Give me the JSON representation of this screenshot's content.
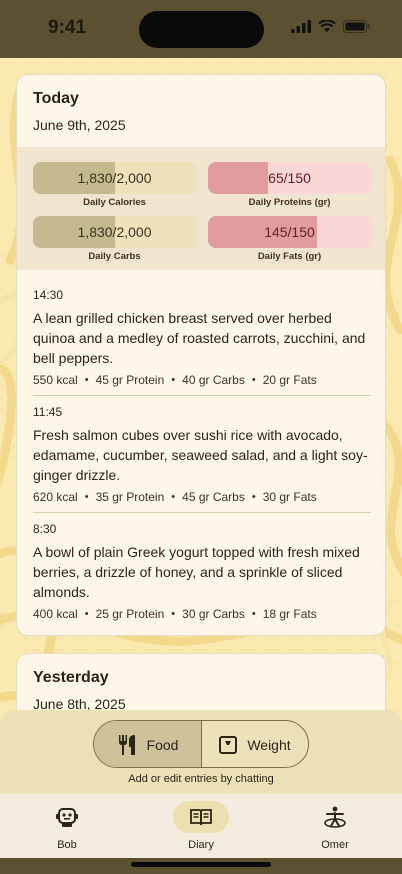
{
  "status": {
    "time": "9:41"
  },
  "today": {
    "title": "Today",
    "date": "June 9th, 2025",
    "stats": [
      {
        "value": "1,830/2,000",
        "label": "Daily Calories",
        "progress": 0.5,
        "color": "#c5b98f"
      },
      {
        "value": "65/150",
        "label": "Daily Proteins (gr)",
        "progress": 0.37,
        "color": "#e09c9f"
      },
      {
        "value": "1,830/2,000",
        "label": "Daily Carbs",
        "progress": 0.5,
        "color": "#c5b98f"
      },
      {
        "value": "145/150",
        "label": "Daily Fats (gr)",
        "progress": 0.67,
        "color": "#e09c9f"
      }
    ],
    "entries": [
      {
        "time": "14:30",
        "description": "A lean grilled chicken breast served over herbed quinoa and a medley of roasted carrots, zucchini, and bell peppers.",
        "kcal": "550 kcal",
        "protein": "45 gr Protein",
        "carbs": "40 gr Carbs",
        "fats": "20 gr Fats"
      },
      {
        "time": "11:45",
        "description": "Fresh salmon cubes over sushi rice with avocado, edamame, cucumber, seaweed salad, and a light soy-ginger drizzle.",
        "kcal": "620 kcal",
        "protein": "35 gr Protein",
        "carbs": "45 gr Carbs",
        "fats": "30 gr Fats"
      },
      {
        "time": "8:30",
        "description": "A bowl of plain Greek yogurt topped with fresh mixed berries, a drizzle of honey, and a sprinkle of sliced almonds.",
        "kcal": "400 kcal",
        "protein": "25 gr Protein",
        "carbs": "30 gr Carbs",
        "fats": "18 gr Fats"
      }
    ],
    "separator": "•"
  },
  "yesterday": {
    "title": "Yesterday",
    "date": "June 8th, 2025"
  },
  "composer": {
    "segments": [
      {
        "label": "Food",
        "icon": "fork-knife-icon",
        "active": true
      },
      {
        "label": "Weight",
        "icon": "scale-icon",
        "active": false
      }
    ],
    "hint": "Add or edit entries by chatting"
  },
  "nav": {
    "items": [
      {
        "label": "Bob",
        "icon": "robot-icon",
        "active": false
      },
      {
        "label": "Diary",
        "icon": "book-icon",
        "active": true
      },
      {
        "label": "Omer",
        "icon": "person-icon",
        "active": false
      }
    ]
  }
}
